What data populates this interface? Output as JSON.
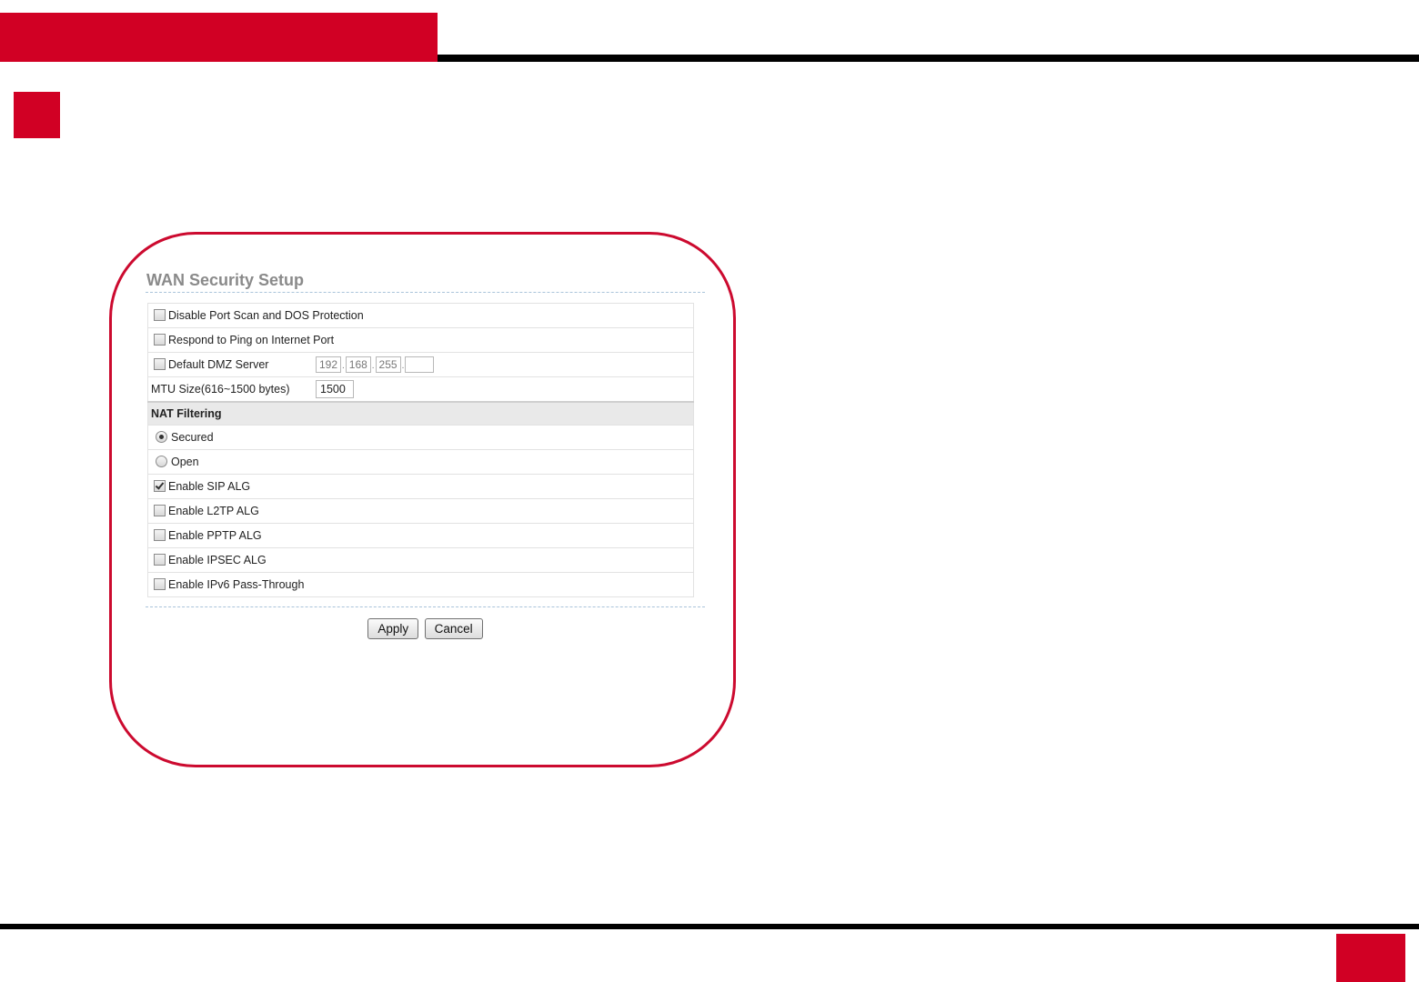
{
  "panel": {
    "title": "WAN Security Setup",
    "options": {
      "disable_port_scan": {
        "label": "Disable Port Scan and DOS Protection",
        "checked": false
      },
      "respond_ping": {
        "label": "Respond to Ping on Internet Port",
        "checked": false
      },
      "default_dmz": {
        "label": "Default DMZ Server",
        "checked": false
      }
    },
    "dmz_ip": {
      "octet1": "192",
      "octet2": "168",
      "octet3": "255",
      "octet4": ""
    },
    "mtu": {
      "label": "MTU Size(616~1500 bytes)",
      "value": "1500"
    },
    "nat": {
      "section_label": "NAT Filtering",
      "secured_label": "Secured",
      "open_label": "Open",
      "selected": "Secured"
    },
    "alg": {
      "sip": {
        "label": "Enable SIP ALG",
        "checked": true
      },
      "l2tp": {
        "label": "Enable L2TP ALG",
        "checked": false
      },
      "pptp": {
        "label": "Enable PPTP ALG",
        "checked": false
      },
      "ipsec": {
        "label": "Enable IPSEC ALG",
        "checked": false
      },
      "ipv6": {
        "label": "Enable IPv6 Pass-Through",
        "checked": false
      }
    },
    "buttons": {
      "apply": "Apply",
      "cancel": "Cancel"
    }
  },
  "colors": {
    "brand_red": "#d10024",
    "frame_red": "#cc0a2f"
  }
}
